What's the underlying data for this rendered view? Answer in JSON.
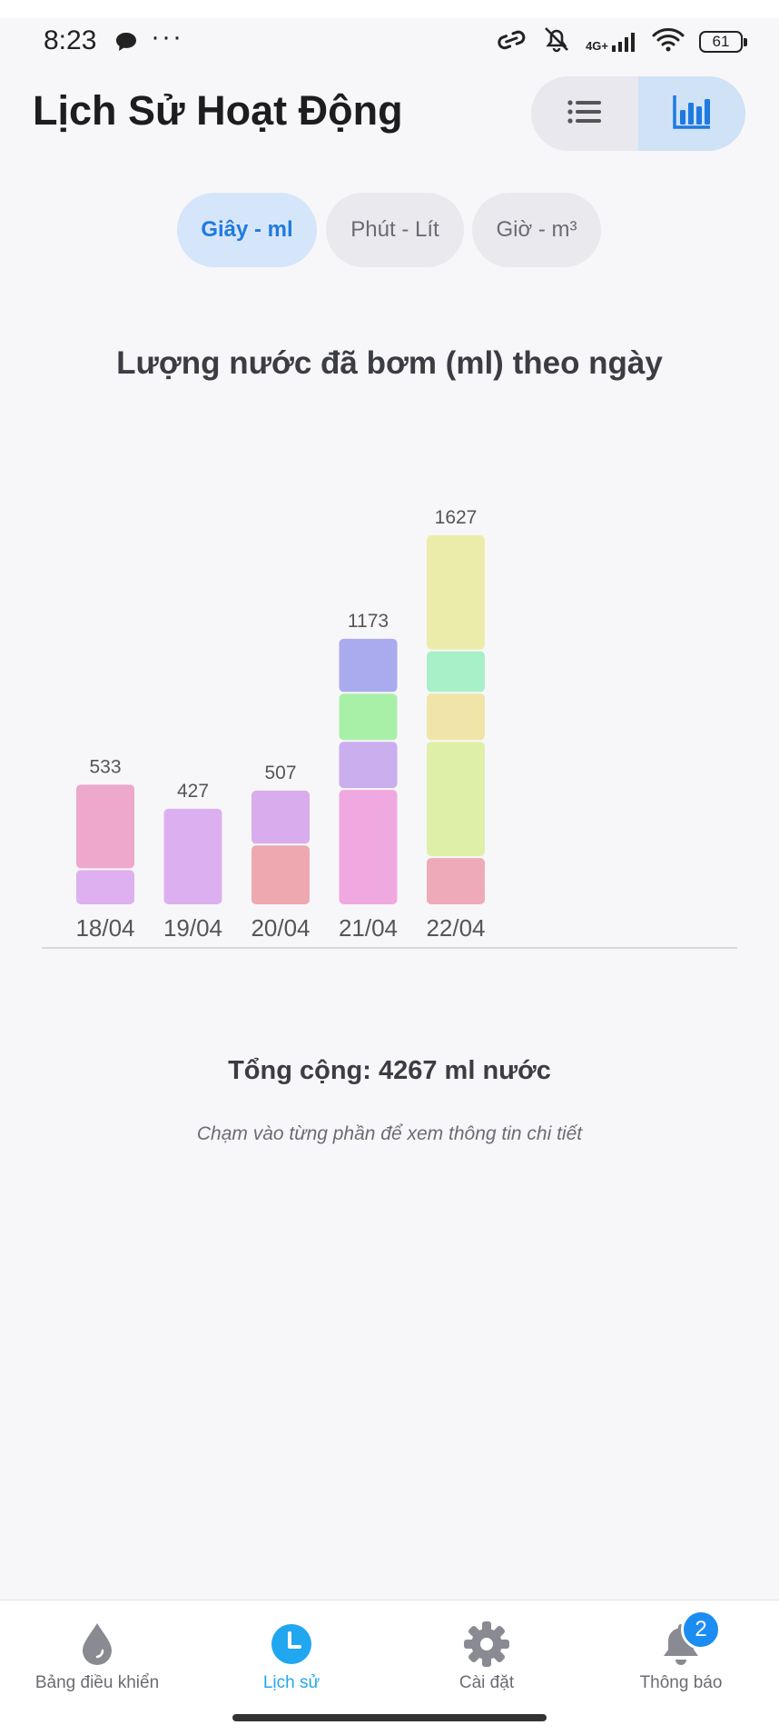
{
  "status_bar": {
    "time": "8:23",
    "dots": "···",
    "network": "4G+",
    "battery": "61"
  },
  "header": {
    "title": "Lịch Sử Hoạt Động",
    "view_toggle": {
      "list_icon": "list-icon",
      "chart_icon": "bar-chart-icon",
      "active": "chart"
    }
  },
  "unit_tabs": [
    {
      "label": "Giây - ml",
      "active": true
    },
    {
      "label": "Phút - Lít",
      "active": false
    },
    {
      "label": "Giờ - m³",
      "active": false
    }
  ],
  "chart_data": {
    "type": "bar",
    "stacked": true,
    "title": "Lượng nước đã bơm (ml) theo ngày",
    "categories": [
      "18/04",
      "19/04",
      "20/04",
      "21/04",
      "22/04"
    ],
    "totals": [
      533,
      427,
      507,
      1173,
      1627
    ],
    "segments": [
      [
        {
          "value": 158,
          "color": "#deb0f0"
        },
        {
          "value": 375,
          "color": "#eda8cc"
        }
      ],
      [
        {
          "value": 427,
          "color": "#dcb0f0"
        }
      ],
      [
        {
          "value": 266,
          "color": "#eda8b0"
        },
        {
          "value": 241,
          "color": "#d9acee"
        }
      ],
      [
        {
          "value": 510,
          "color": "#f0a8e0"
        },
        {
          "value": 211,
          "color": "#caaeee"
        },
        {
          "value": 211,
          "color": "#a8f0a8"
        },
        {
          "value": 241,
          "color": "#aaaaee"
        }
      ],
      [
        {
          "value": 211,
          "color": "#eeaab8"
        },
        {
          "value": 510,
          "color": "#def0a8"
        },
        {
          "value": 211,
          "color": "#f0e4a8"
        },
        {
          "value": 186,
          "color": "#a8f0c8"
        },
        {
          "value": 509,
          "color": "#ecec aa"
        }
      ]
    ],
    "ylim": [
      0,
      1627
    ],
    "legend": "none",
    "grid": false
  },
  "summary": {
    "total": "Tổng cộng: 4267 ml nước",
    "hint": "Chạm vào từng phần để xem thông tin chi tiết"
  },
  "bottom_nav": [
    {
      "label": "Bảng điều khiển",
      "icon": "water-drop-icon",
      "active": false
    },
    {
      "label": "Lịch sử",
      "icon": "clock-icon",
      "active": true
    },
    {
      "label": "Cài đặt",
      "icon": "gear-icon",
      "active": false
    },
    {
      "label": "Thông báo",
      "icon": "bell-icon",
      "active": false,
      "badge": "2"
    }
  ]
}
